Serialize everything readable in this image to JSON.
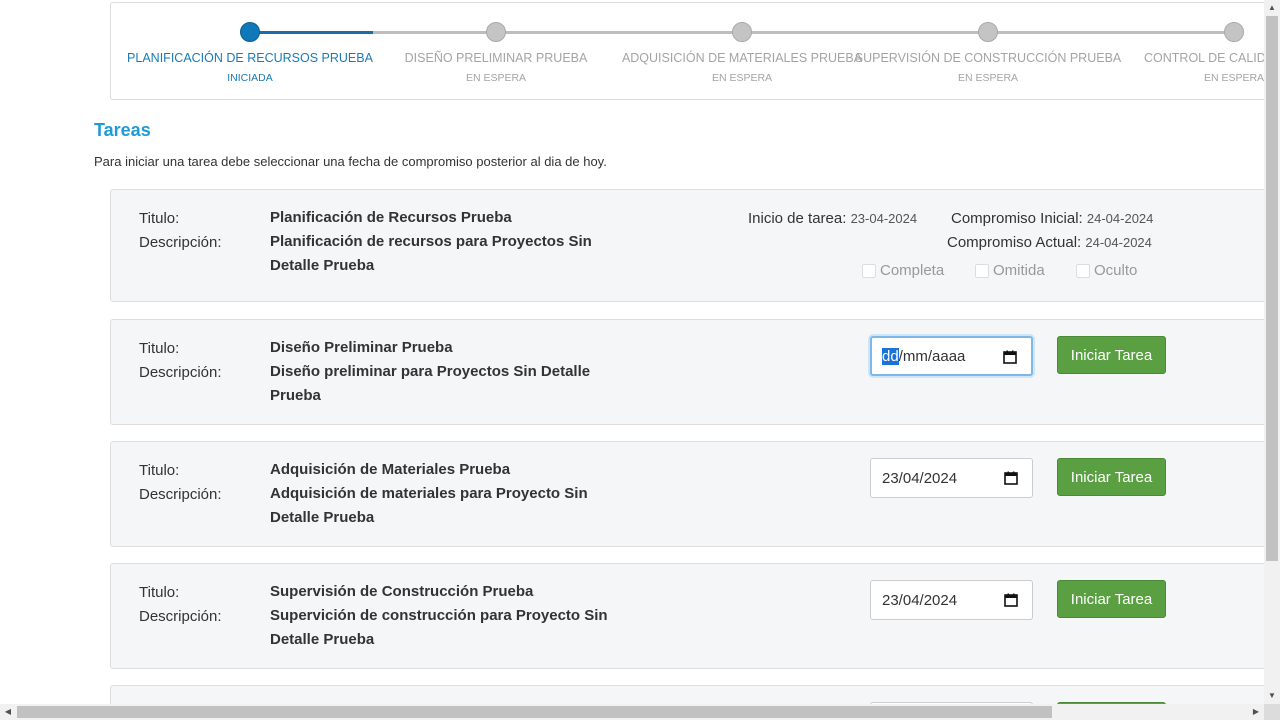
{
  "stepper": {
    "steps": [
      {
        "name": "PLANIFICACIÓN DE RECURSOS PRUEBA",
        "status": "INICIADA"
      },
      {
        "name": "DISEÑO PRELIMINAR PRUEBA",
        "status": "EN ESPERA"
      },
      {
        "name": "ADQUISICIÓN DE MATERIALES PRUEBA",
        "status": "EN ESPERA"
      },
      {
        "name": "SUPERVISIÓN DE CONSTRUCCIÓN PRUEBA",
        "status": "EN ESPERA"
      },
      {
        "name": "CONTROL DE CALIDA",
        "status": "EN ESPERA"
      }
    ],
    "active_index": 0
  },
  "section": {
    "title": "Tareas",
    "hint": "Para iniciar una tarea debe seleccionar una fecha de compromiso posterior al dia de hoy."
  },
  "labels": {
    "titulo": "Titulo:",
    "descripcion": "Descripción:"
  },
  "tasks": [
    {
      "title": "Planificación de Recursos Prueba",
      "description": "Planificación de recursos para Proyectos Sin Detalle Prueba",
      "start_label": "Inicio de tarea:",
      "start_date": "23-04-2024",
      "initial_label": "Compromiso Inicial:",
      "initial_date": "24-04-2024",
      "current_label": "Compromiso Actual:",
      "current_date": "24-04-2024",
      "checks": [
        "Completa",
        "Omitida",
        "Oculto"
      ]
    },
    {
      "title": "Diseño Preliminar Prueba",
      "description": "Diseño preliminar para Proyectos Sin Detalle Prueba",
      "date_hl": "dd",
      "date_rest": "/mm/aaaa",
      "button": "Iniciar Tarea"
    },
    {
      "title": "Adquisición de Materiales Prueba",
      "description": "Adquisición de materiales para Proyecto Sin Detalle Prueba",
      "date": "23/04/2024",
      "button": "Iniciar Tarea"
    },
    {
      "title": "Supervisión de Construcción Prueba",
      "description": "Supervición de construcción para Proyecto Sin Detalle Prueba",
      "date": "23/04/2024",
      "button": "Iniciar Tarea"
    }
  ],
  "colors": {
    "accent": "#1f9ad6",
    "step_active": "#0e78b8",
    "button_green": "#5aa043"
  }
}
